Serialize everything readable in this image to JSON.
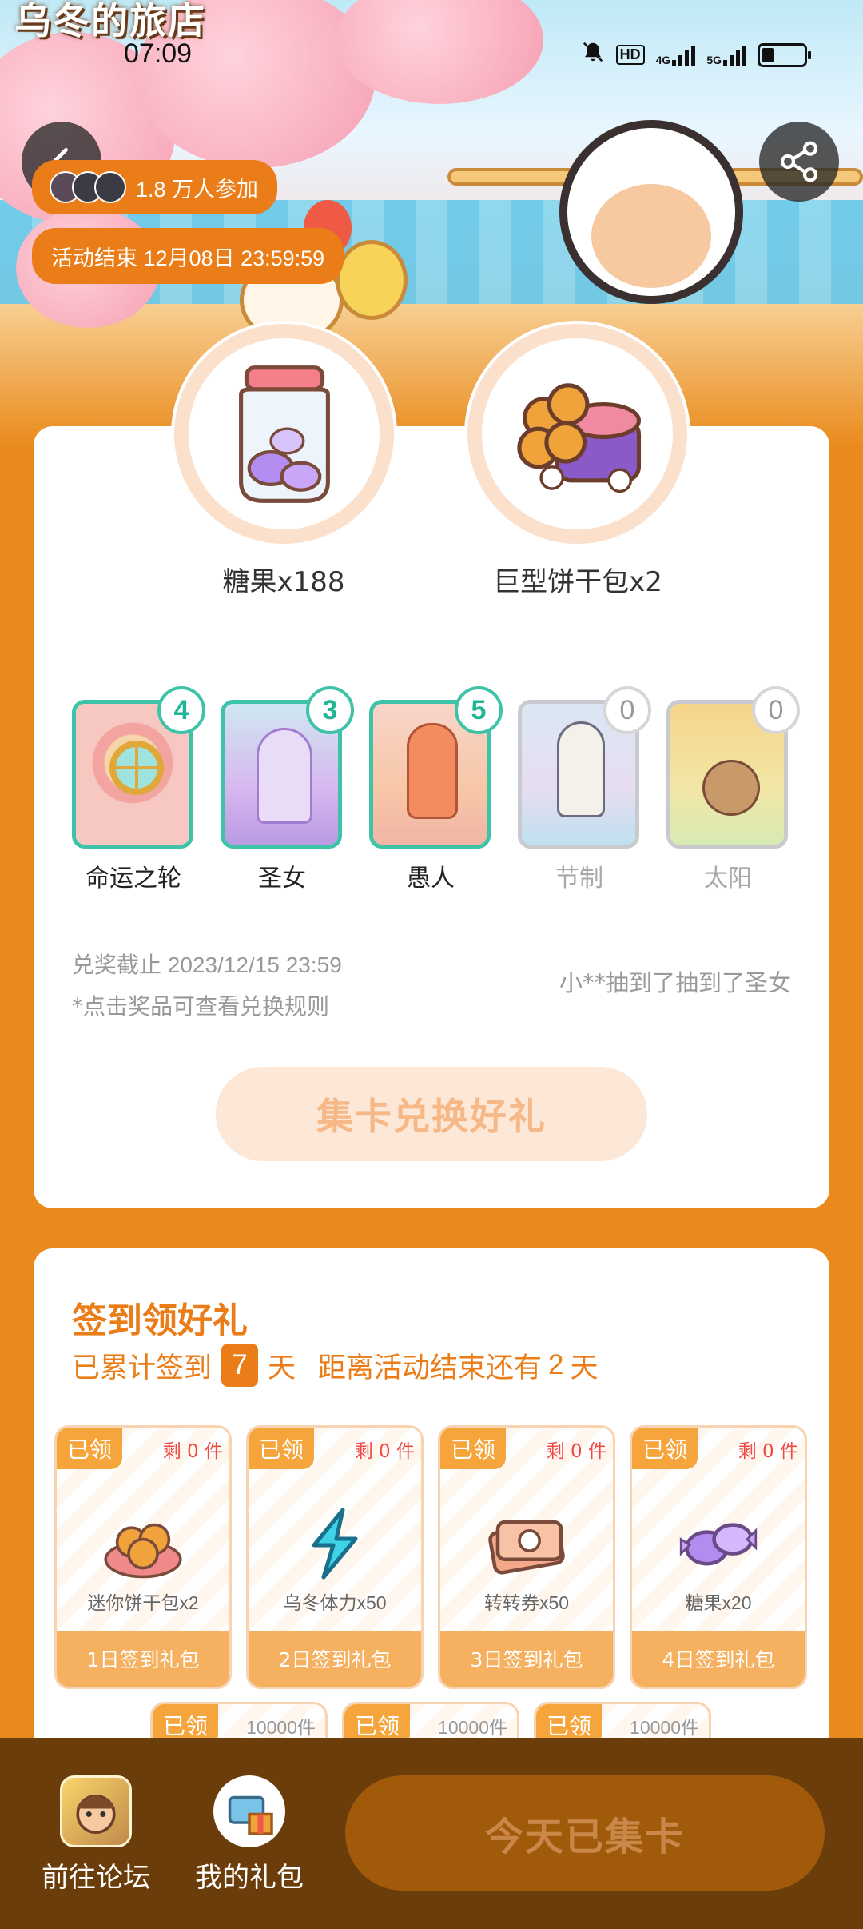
{
  "status_bar": {
    "time": "07:09",
    "network_hd": "HD",
    "network_4g": "4G",
    "network_5g": "5G"
  },
  "header": {
    "logo_text": "乌冬的旅店",
    "participants": "1.8 万人参加",
    "activity_end": "活动结束 12月08日 23:59:59"
  },
  "prizes": {
    "items": [
      {
        "label": "糖果x188"
      },
      {
        "label": "巨型饼干包x2"
      }
    ],
    "cards": [
      {
        "name": "命运之轮",
        "count": "4",
        "owned": true
      },
      {
        "name": "圣女",
        "count": "3",
        "owned": true
      },
      {
        "name": "愚人",
        "count": "5",
        "owned": true
      },
      {
        "name": "节制",
        "count": "0",
        "owned": false
      },
      {
        "name": "太阳",
        "count": "0",
        "owned": false
      }
    ],
    "redeem_deadline": "兑奖截止 2023/12/15 23:59",
    "hint": "*点击奖品可查看兑换规则",
    "ticker": "小**抽到了抽到了圣女",
    "collect_button": "集卡兑换好礼"
  },
  "signin": {
    "title": "签到领好礼",
    "sub_prefix": "已累计签到",
    "days": "7",
    "sub_unit": "天",
    "remaining_prefix": "距离活动结束还有",
    "remaining_days": "2",
    "remaining_unit": "天",
    "gifts": [
      {
        "status": "已领",
        "stock": "剩 0 件",
        "name": "迷你饼干包x2",
        "footer": "1日签到礼包"
      },
      {
        "status": "已领",
        "stock": "剩 0 件",
        "name": "乌冬体力x50",
        "footer": "2日签到礼包"
      },
      {
        "status": "已领",
        "stock": "剩 0 件",
        "name": "转转券x50",
        "footer": "3日签到礼包"
      },
      {
        "status": "已领",
        "stock": "剩 0 件",
        "name": "糖果x20",
        "footer": "4日签到礼包"
      }
    ],
    "more_gifts": [
      {
        "status": "已领",
        "stock": "10000件"
      },
      {
        "status": "已领",
        "stock": "10000件"
      },
      {
        "status": "已领",
        "stock": "10000件"
      }
    ]
  },
  "bottom_bar": {
    "forum_label": "前往论坛",
    "gifts_label": "我的礼包",
    "today_button": "今天已集卡"
  },
  "colors": {
    "accent": "#ea7d17",
    "teal": "#3fc3a8",
    "bottom_bar": "#6b3d0a"
  }
}
